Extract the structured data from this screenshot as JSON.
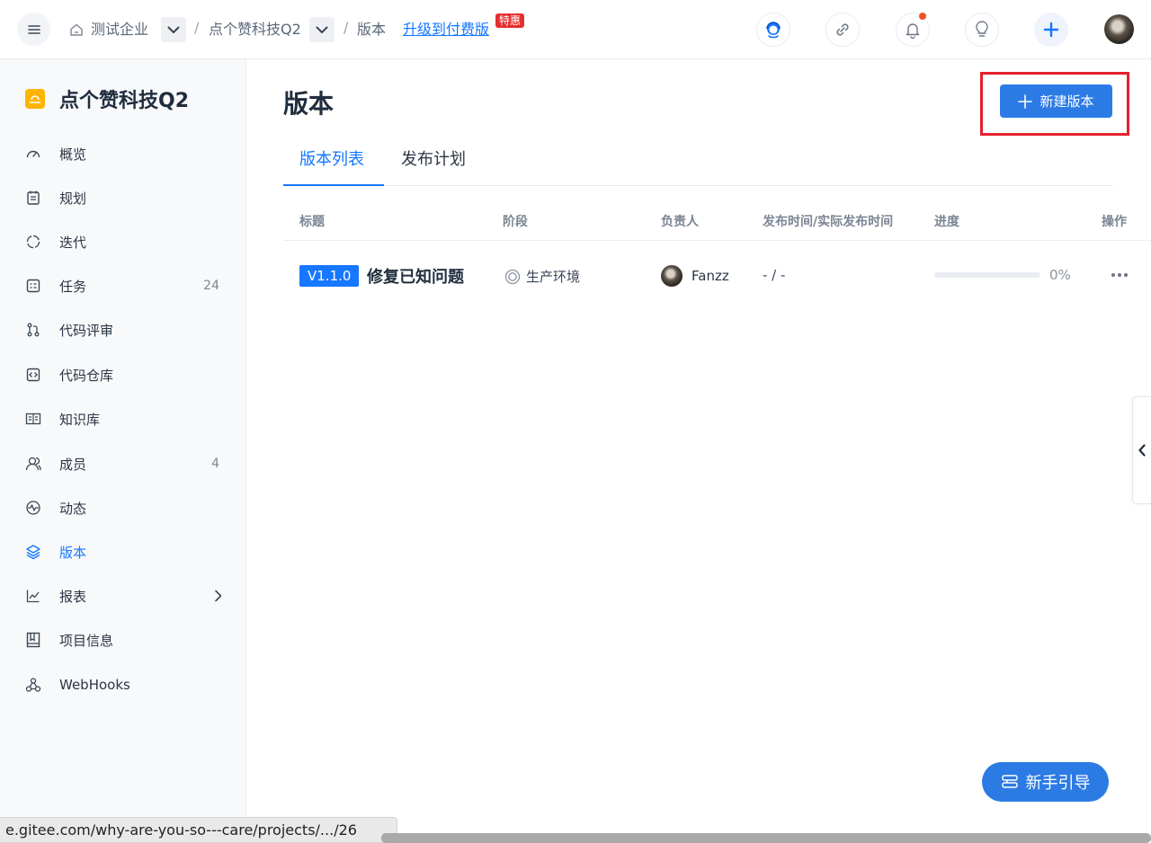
{
  "header": {
    "breadcrumb": {
      "enterprise": "测试企业",
      "project": "点个赞科技Q2",
      "current": "版本",
      "separator": "/"
    },
    "upgrade_link": "升级到付费版",
    "hot_badge": "特惠"
  },
  "sidebar": {
    "project_name": "点个赞科技Q2",
    "items": [
      {
        "label": "概览",
        "icon": "dashboard-icon",
        "count": ""
      },
      {
        "label": "规划",
        "icon": "calendar-icon",
        "count": ""
      },
      {
        "label": "迭代",
        "icon": "cycle-icon",
        "count": ""
      },
      {
        "label": "任务",
        "icon": "task-icon",
        "count": "24"
      },
      {
        "label": "代码评审",
        "icon": "pull-request-icon",
        "count": ""
      },
      {
        "label": "代码仓库",
        "icon": "code-icon",
        "count": ""
      },
      {
        "label": "知识库",
        "icon": "book-open-icon",
        "count": ""
      },
      {
        "label": "成员",
        "icon": "users-icon",
        "count": "4"
      },
      {
        "label": "动态",
        "icon": "activity-icon",
        "count": ""
      },
      {
        "label": "版本",
        "icon": "layers-icon",
        "count": "",
        "active": true
      },
      {
        "label": "报表",
        "icon": "chart-icon",
        "count": ""
      },
      {
        "label": "项目信息",
        "icon": "info-book-icon",
        "count": ""
      },
      {
        "label": "WebHooks",
        "icon": "webhook-icon",
        "count": ""
      }
    ]
  },
  "main": {
    "title": "版本",
    "new_button": "新建版本",
    "tabs": [
      {
        "label": "版本列表",
        "active": true
      },
      {
        "label": "发布计划",
        "active": false
      }
    ],
    "columns": [
      "标题",
      "阶段",
      "负责人",
      "发布时间/实际发布时间",
      "进度",
      "操作"
    ],
    "rows": [
      {
        "version": "V1.1.0",
        "title": "修复已知问题",
        "stage": "生产环境",
        "owner": "Fanzz",
        "publish_time": "- / -",
        "progress": 0,
        "progress_label": "0%"
      }
    ]
  },
  "guide_button": "新手引导",
  "status_bar": {
    "url": "e.gitee.com/why-are-you-so---care/projects/.../26"
  },
  "colors": {
    "accent": "#1677ff",
    "button": "#2c7be5",
    "highlight_box": "#e5202e",
    "project_logo": "#ffb400"
  }
}
